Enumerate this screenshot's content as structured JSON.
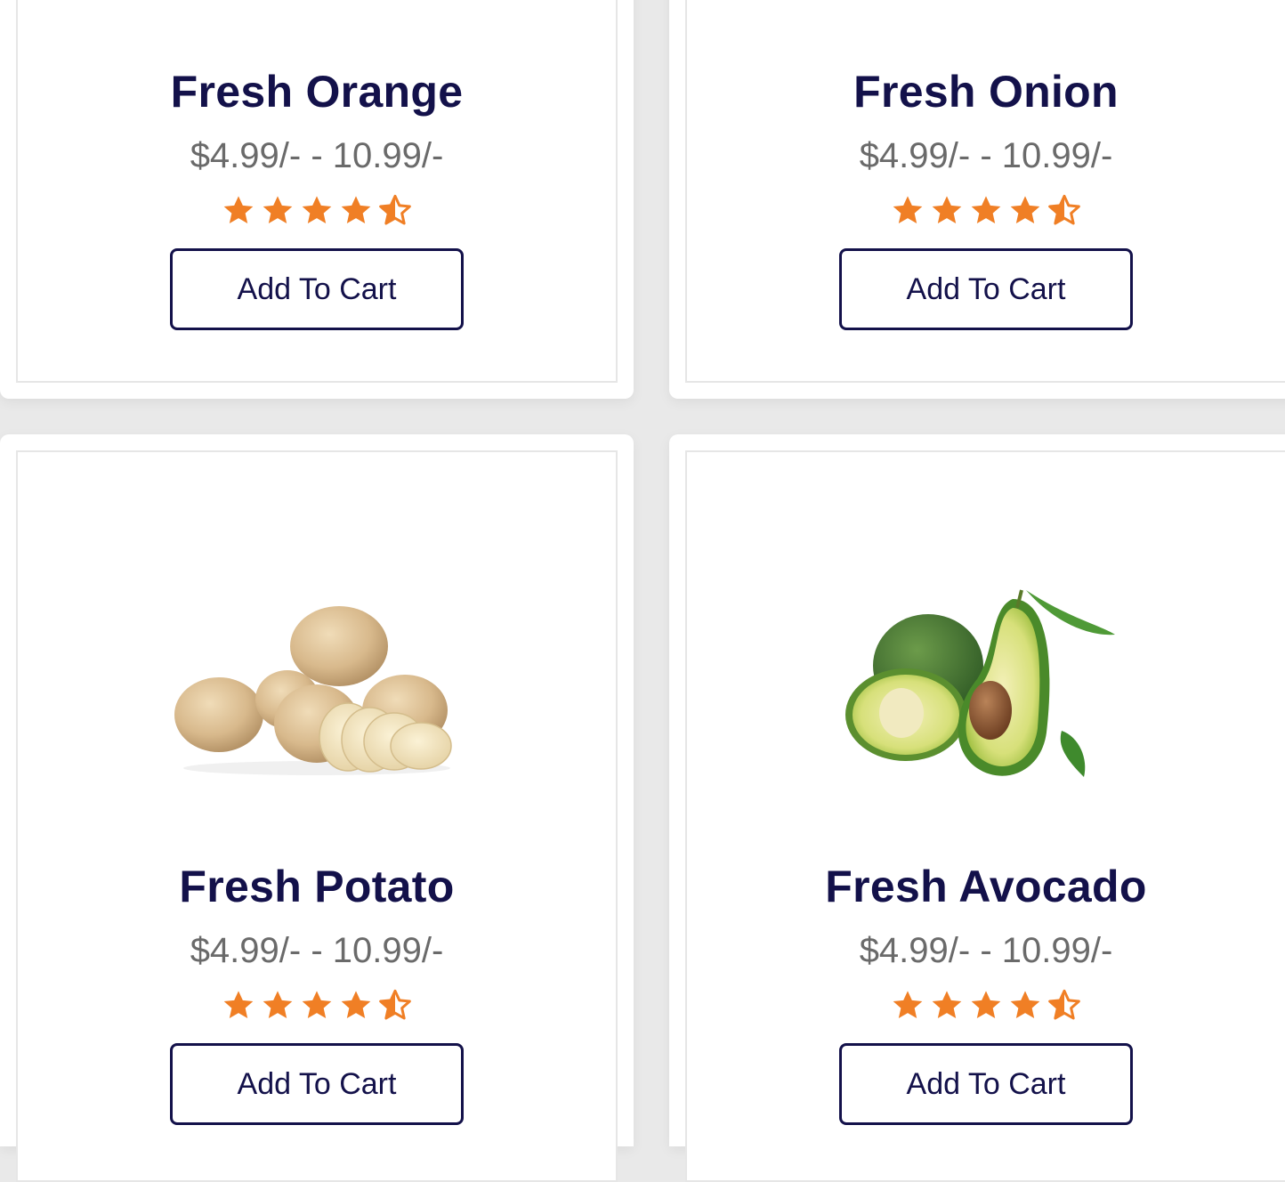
{
  "products": [
    {
      "name": "Fresh Orange",
      "price": "$4.99/- - 10.99/-",
      "rating": 4.5,
      "button": "Add To Cart",
      "image_icon": "orange-image"
    },
    {
      "name": "Fresh Onion",
      "price": "$4.99/- - 10.99/-",
      "rating": 4.5,
      "button": "Add To Cart",
      "image_icon": "onion-image"
    },
    {
      "name": "Fresh Potato",
      "price": "$4.99/- - 10.99/-",
      "rating": 4.5,
      "button": "Add To Cart",
      "image_icon": "potato-image"
    },
    {
      "name": "Fresh Avocado",
      "price": "$4.99/- - 10.99/-",
      "rating": 4.5,
      "button": "Add To Cart",
      "image_icon": "avocado-image"
    }
  ],
  "colors": {
    "title": "#13114a",
    "price": "#6a6a6a",
    "star": "#f07f25",
    "page_bg": "#e9e9e9"
  }
}
